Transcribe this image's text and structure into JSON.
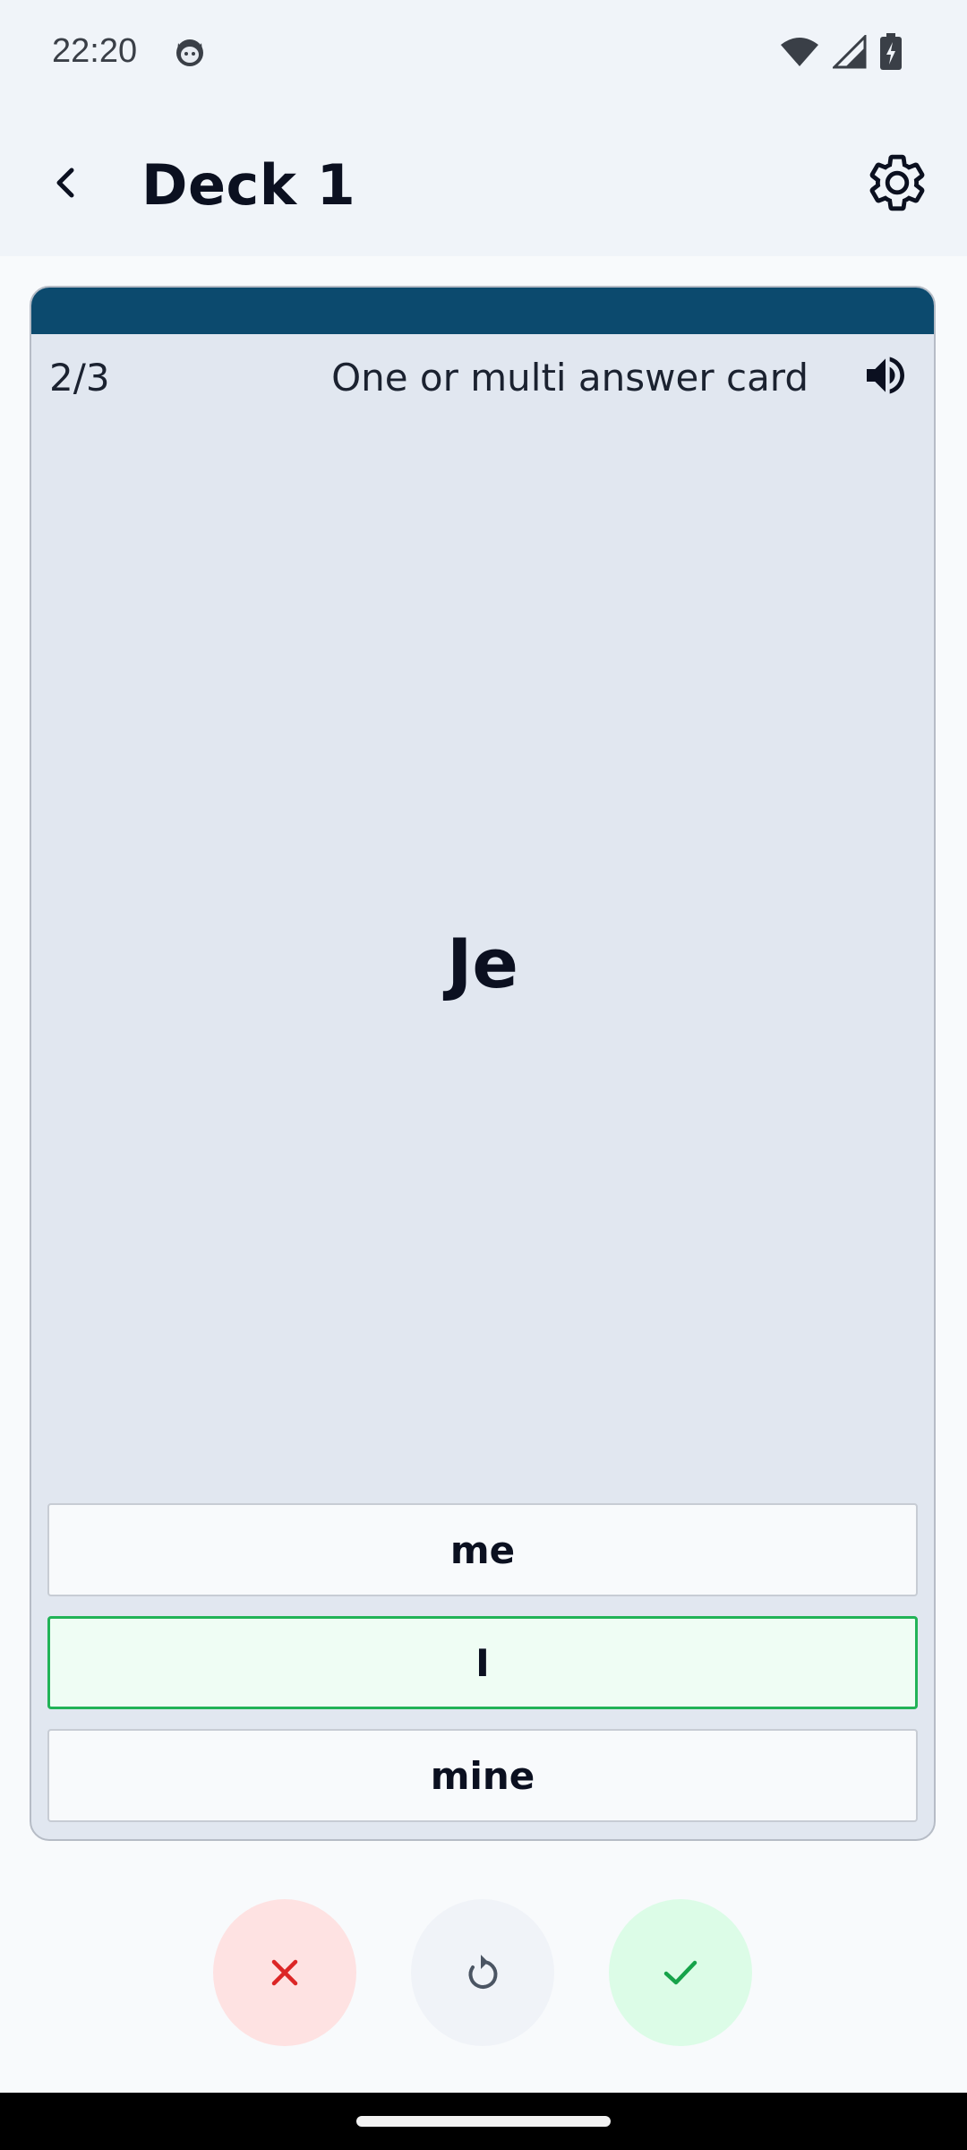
{
  "status_bar": {
    "time": "22:20",
    "icons": [
      "cat-icon",
      "wifi-icon",
      "cellular-signal-icon",
      "battery-charging-icon"
    ]
  },
  "app_bar": {
    "back_icon": "chevron-left-icon",
    "title": "Deck 1",
    "settings_icon": "gear-icon"
  },
  "card": {
    "counter": "2/3",
    "type_label": "One or multi answer card",
    "sound_icon": "speaker-icon",
    "word": "Je",
    "band_color": "#0c4a6e",
    "answers": [
      {
        "label": "me",
        "state": "default"
      },
      {
        "label": "I",
        "state": "correct"
      },
      {
        "label": "mine",
        "state": "default"
      }
    ]
  },
  "actions": {
    "wrong_icon": "close-icon",
    "reset_icon": "refresh-icon",
    "right_icon": "check-icon",
    "wrong_color": "#dc2626",
    "right_color": "#16a34a"
  }
}
